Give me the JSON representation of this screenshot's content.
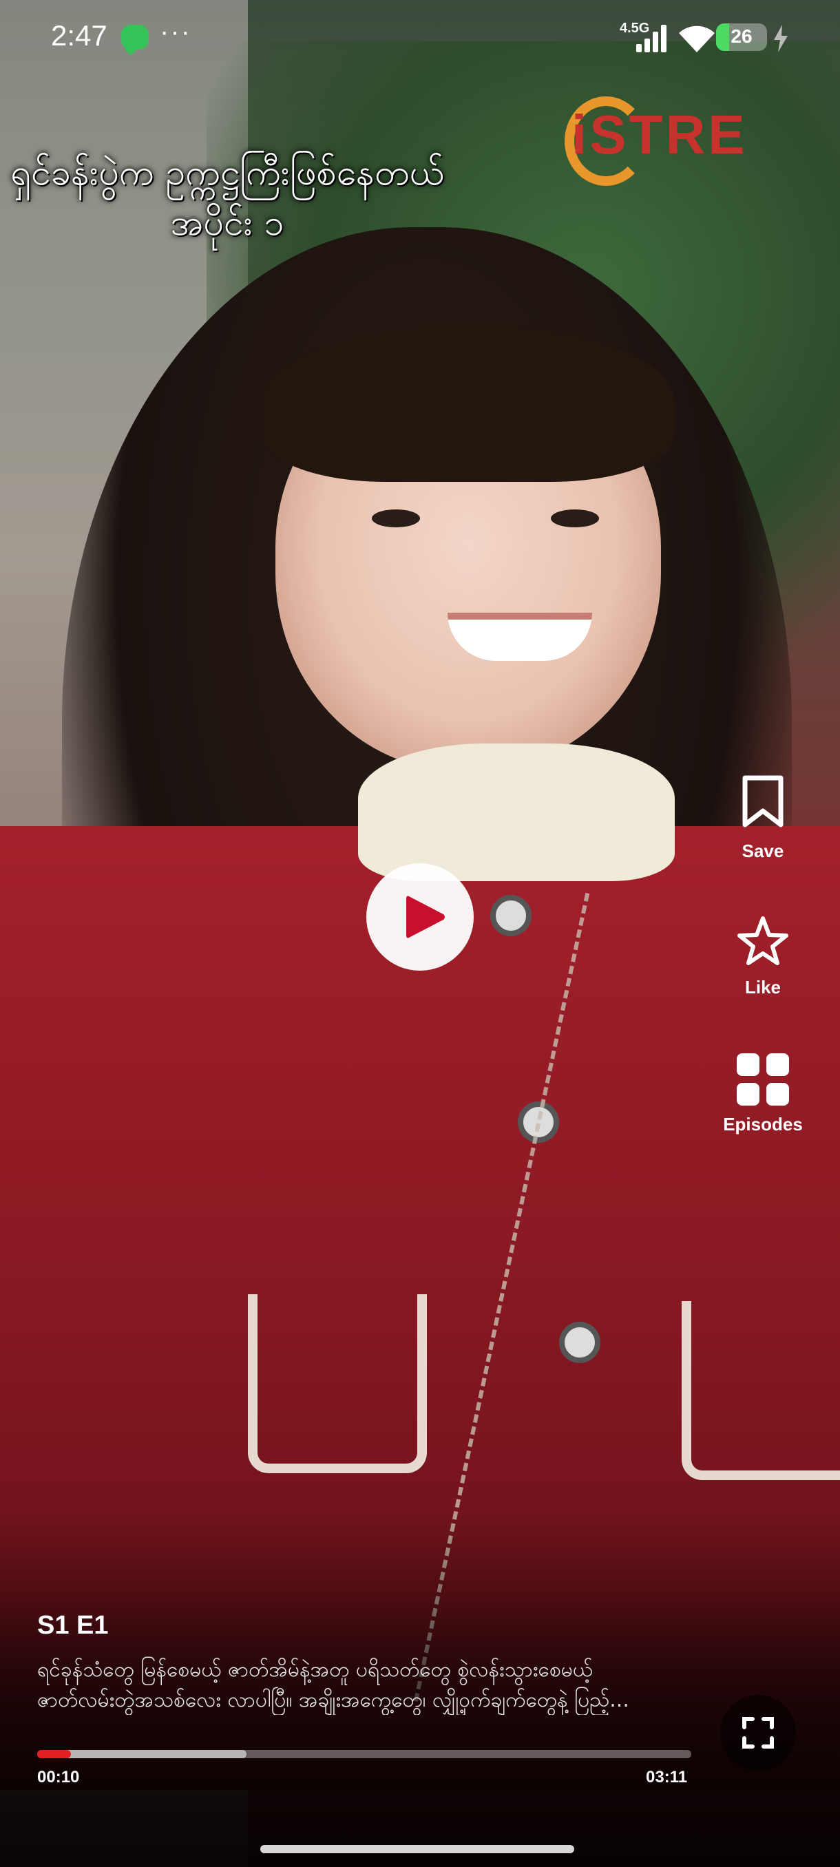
{
  "status_bar": {
    "time": "2:47",
    "network": "4.5G",
    "battery": "26",
    "battery_level": 0.26,
    "icons": [
      "messages-icon",
      "more-dots-icon",
      "signal-icon",
      "wifi-icon",
      "battery-icon",
      "charging-icon"
    ]
  },
  "video": {
    "logo_text": "iSTRE",
    "overlay_lines": [
      "ရှင်ခန်းပွဲက ဥက္ကဋ္ဌကြီးဖြစ်နေတယ်",
      "အပိုင်း ၁"
    ],
    "state": "paused"
  },
  "actions": {
    "save_label": "Save",
    "like_label": "Like",
    "episodes_label": "Episodes"
  },
  "episode": {
    "title": "S1 E1",
    "description_line1": "ရင်ခုန်သံတွေ မြန်စေမယ့် ဇာတ်အိမ်နဲ့အတူ ပရိသတ်တွေ စွဲလန်းသွားစေမယ့်",
    "description_line2": "ဇာတ်လမ်းတွဲအသစ်လေး လာပါပြီ။ အချိုးအကွေ့တွေ၊ လျှို့ဝှက်ချက်တွေနဲ့ ပြည့်..."
  },
  "player": {
    "current_time": "00:10",
    "duration": "03:11",
    "played_fraction": 0.052,
    "buffered_fraction": 0.32,
    "accent_color": "#e02020"
  }
}
